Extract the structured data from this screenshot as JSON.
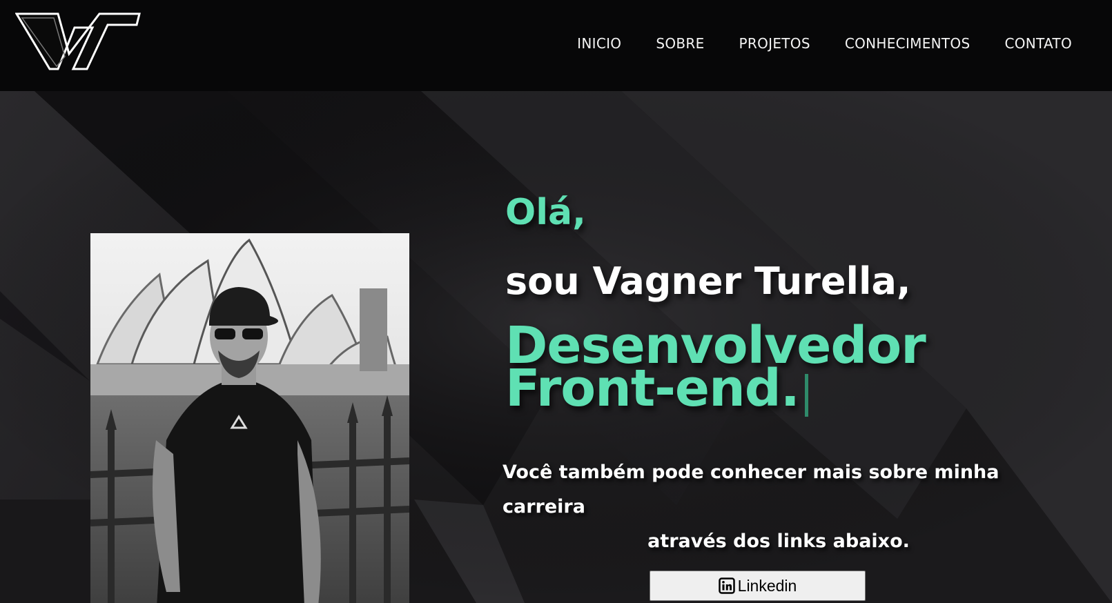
{
  "brand": {
    "logo_text": "VT"
  },
  "nav": {
    "items": [
      {
        "label": "INICIO"
      },
      {
        "label": "SOBRE"
      },
      {
        "label": "PROJETOS"
      },
      {
        "label": "CONHECIMENTOS"
      },
      {
        "label": "CONTATO"
      }
    ]
  },
  "hero": {
    "greeting": "Olá,",
    "intro": "sou Vagner Turella,",
    "role_line1": "Desenvolvedor",
    "role_line2": "Front-end.",
    "description_line1": "Você também pode conhecer mais sobre minha carreira",
    "description_line2": "através dos links abaixo.",
    "linkedin_label": "Linkedin",
    "linkedin_icon": "linkedin-icon"
  },
  "colors": {
    "accent": "#5fe0b3",
    "header_bg": "#070708",
    "button_bg": "#efefef"
  }
}
